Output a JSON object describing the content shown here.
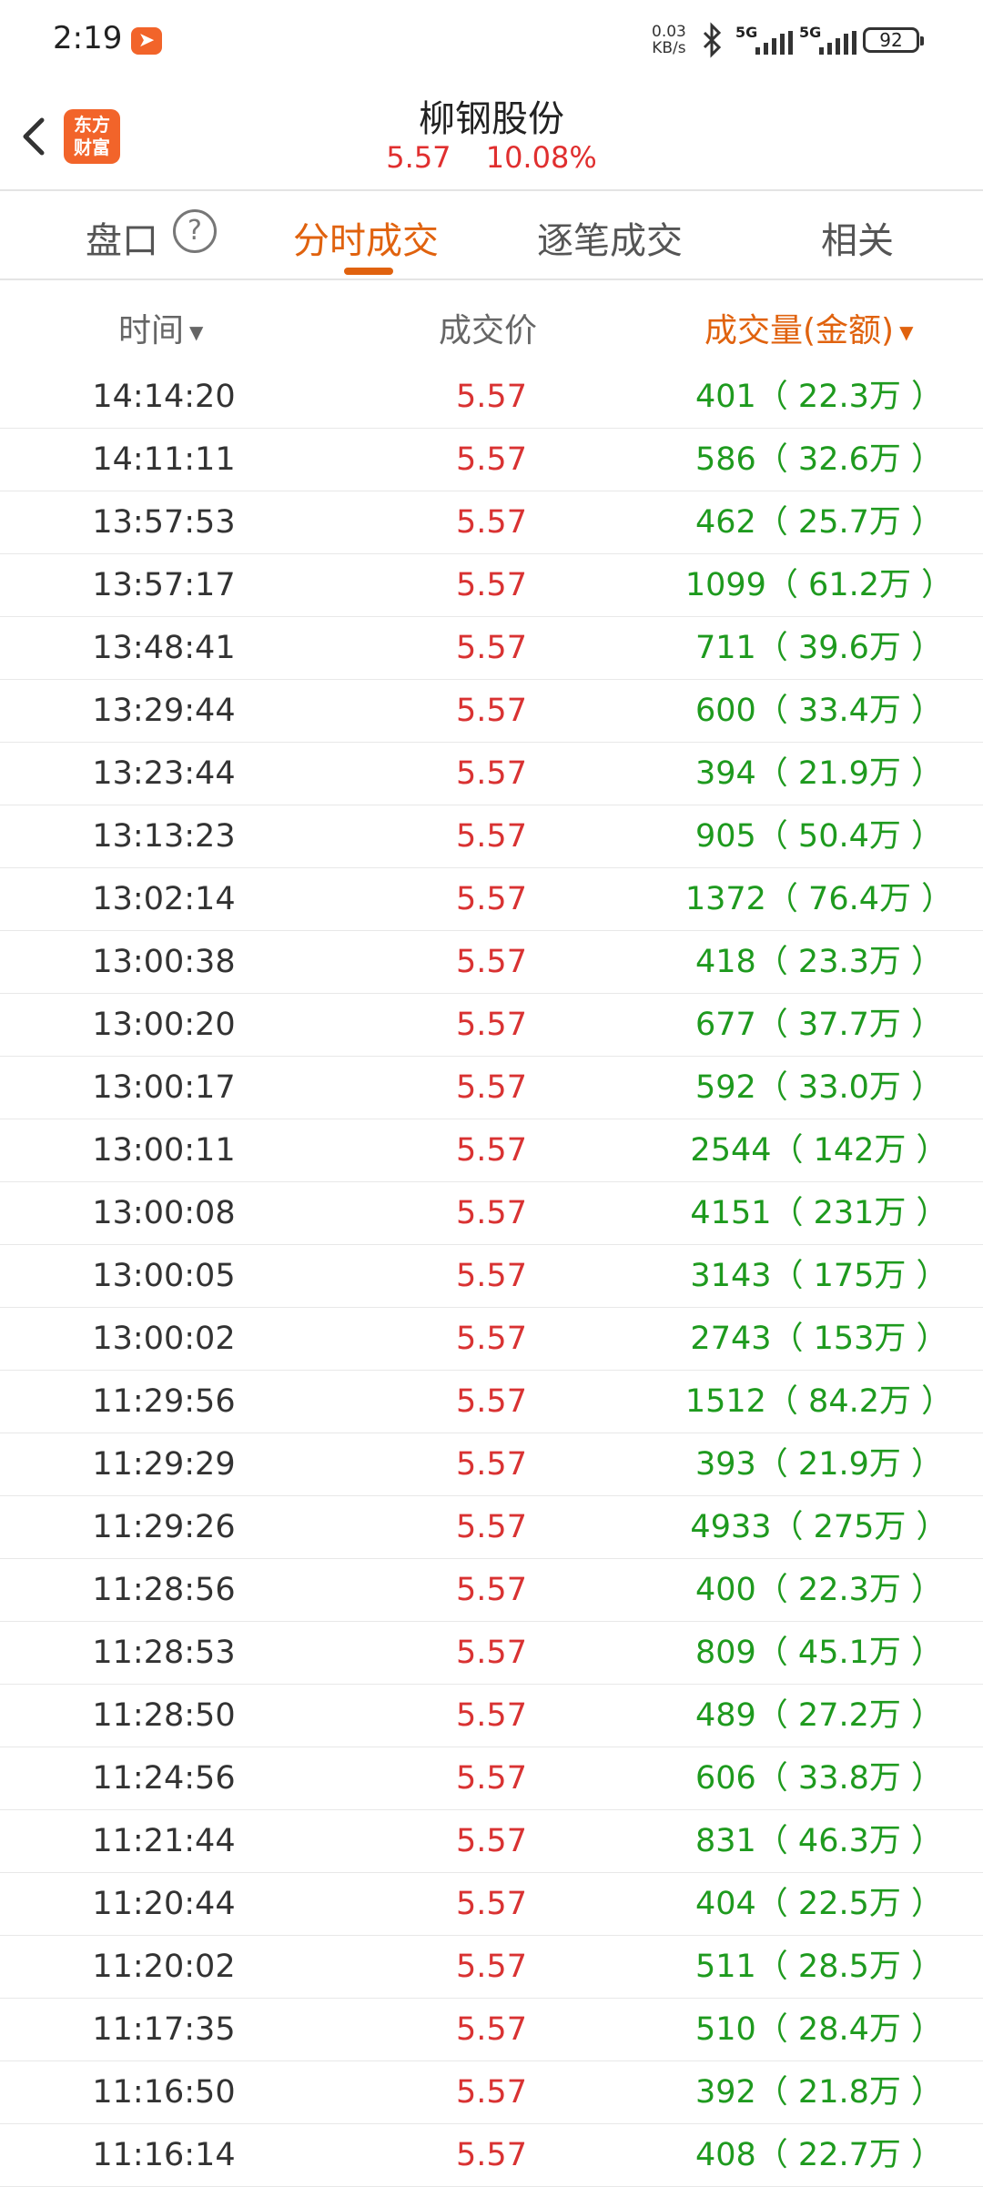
{
  "status_bar": {
    "time": "2:19",
    "app_icon": "feishu-icon",
    "net_speed_value": "0.03",
    "net_speed_unit": "KB/s",
    "sig1_label": "5G",
    "sig2_label": "5G",
    "battery": "92"
  },
  "header": {
    "logo_line1": "东方",
    "logo_line2": "财富",
    "stock_name": "柳钢股份",
    "price": "5.57",
    "change_pct": "10.08%",
    "price_color": "#e02f2f"
  },
  "tabs": [
    {
      "label": "盘口",
      "active": false
    },
    {
      "label": "分时成交",
      "active": true
    },
    {
      "label": "逐笔成交",
      "active": false
    },
    {
      "label": "相关",
      "active": false
    }
  ],
  "help_icon_glyph": "?",
  "columns": {
    "time": "时间",
    "price": "成交价",
    "volume": "成交量(金额)"
  },
  "colors": {
    "accent": "#e0620e",
    "up_red": "#d93232",
    "volume_green": "#1e9a1e"
  },
  "trades": [
    {
      "time": "14:14:20",
      "price": "5.57",
      "volume": "401（ 22.3万 ）"
    },
    {
      "time": "14:11:11",
      "price": "5.57",
      "volume": "586（ 32.6万 ）"
    },
    {
      "time": "13:57:53",
      "price": "5.57",
      "volume": "462（ 25.7万 ）"
    },
    {
      "time": "13:57:17",
      "price": "5.57",
      "volume": "1099（ 61.2万 ）"
    },
    {
      "time": "13:48:41",
      "price": "5.57",
      "volume": "711（ 39.6万 ）"
    },
    {
      "time": "13:29:44",
      "price": "5.57",
      "volume": "600（ 33.4万 ）"
    },
    {
      "time": "13:23:44",
      "price": "5.57",
      "volume": "394（ 21.9万 ）"
    },
    {
      "time": "13:13:23",
      "price": "5.57",
      "volume": "905（ 50.4万 ）"
    },
    {
      "time": "13:02:14",
      "price": "5.57",
      "volume": "1372（ 76.4万 ）"
    },
    {
      "time": "13:00:38",
      "price": "5.57",
      "volume": "418（ 23.3万 ）"
    },
    {
      "time": "13:00:20",
      "price": "5.57",
      "volume": "677（ 37.7万 ）"
    },
    {
      "time": "13:00:17",
      "price": "5.57",
      "volume": "592（ 33.0万 ）"
    },
    {
      "time": "13:00:11",
      "price": "5.57",
      "volume": "2544（ 142万 ）"
    },
    {
      "time": "13:00:08",
      "price": "5.57",
      "volume": "4151（ 231万 ）"
    },
    {
      "time": "13:00:05",
      "price": "5.57",
      "volume": "3143（ 175万 ）"
    },
    {
      "time": "13:00:02",
      "price": "5.57",
      "volume": "2743（ 153万 ）"
    },
    {
      "time": "11:29:56",
      "price": "5.57",
      "volume": "1512（ 84.2万 ）"
    },
    {
      "time": "11:29:29",
      "price": "5.57",
      "volume": "393（ 21.9万 ）"
    },
    {
      "time": "11:29:26",
      "price": "5.57",
      "volume": "4933（ 275万 ）"
    },
    {
      "time": "11:28:56",
      "price": "5.57",
      "volume": "400（ 22.3万 ）"
    },
    {
      "time": "11:28:53",
      "price": "5.57",
      "volume": "809（ 45.1万 ）"
    },
    {
      "time": "11:28:50",
      "price": "5.57",
      "volume": "489（ 27.2万 ）"
    },
    {
      "time": "11:24:56",
      "price": "5.57",
      "volume": "606（ 33.8万 ）"
    },
    {
      "time": "11:21:44",
      "price": "5.57",
      "volume": "831（ 46.3万 ）"
    },
    {
      "time": "11:20:44",
      "price": "5.57",
      "volume": "404（ 22.5万 ）"
    },
    {
      "time": "11:20:02",
      "price": "5.57",
      "volume": "511（ 28.5万 ）"
    },
    {
      "time": "11:17:35",
      "price": "5.57",
      "volume": "510（ 28.4万 ）"
    },
    {
      "time": "11:16:50",
      "price": "5.57",
      "volume": "392（ 21.8万 ）"
    },
    {
      "time": "11:16:14",
      "price": "5.57",
      "volume": "408（ 22.7万 ）"
    }
  ]
}
